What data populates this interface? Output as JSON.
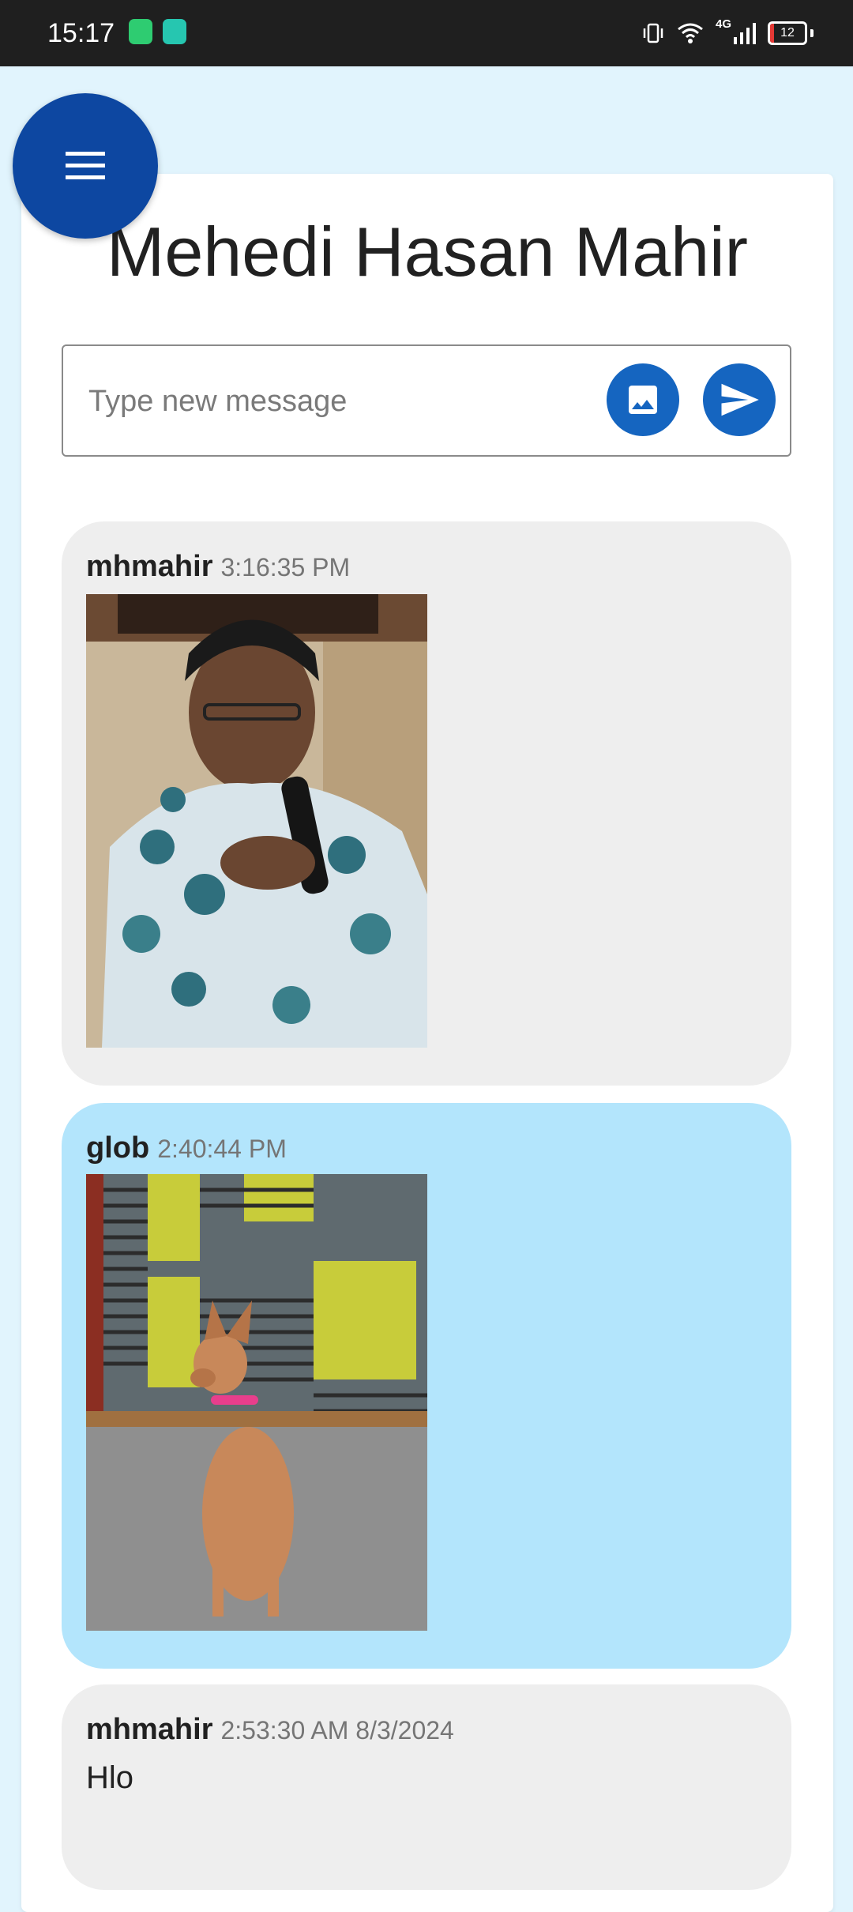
{
  "status_bar": {
    "time": "15:17",
    "network": "4G",
    "battery_level": "12",
    "battery_fraction": 0.12
  },
  "header": {
    "title": "Mehedi Hasan Mahir",
    "menu_icon": "hamburger-menu-icon"
  },
  "composer": {
    "placeholder": "Type new message",
    "image_icon": "image-icon",
    "send_icon": "send-icon"
  },
  "messages": [
    {
      "user": "mhmahir",
      "time": "3:16:35 PM",
      "type": "image",
      "image": "photo of a man in a patterned shirt speaking into a microphone"
    },
    {
      "user": "glob",
      "time": "2:40:44 PM",
      "type": "image",
      "image": "photo of a tan dog with a pink collar sitting on pavement"
    },
    {
      "user": "mhmahir",
      "time": "2:53:30 AM 8/3/2024",
      "type": "text",
      "text": "Hlo"
    }
  ],
  "colors": {
    "page_bg": "#e1f4fd",
    "primary": "#1565c0",
    "menu_fab": "#0d47a1",
    "bubble_self": "#eeeeee",
    "bubble_other": "#b3e5fc"
  }
}
